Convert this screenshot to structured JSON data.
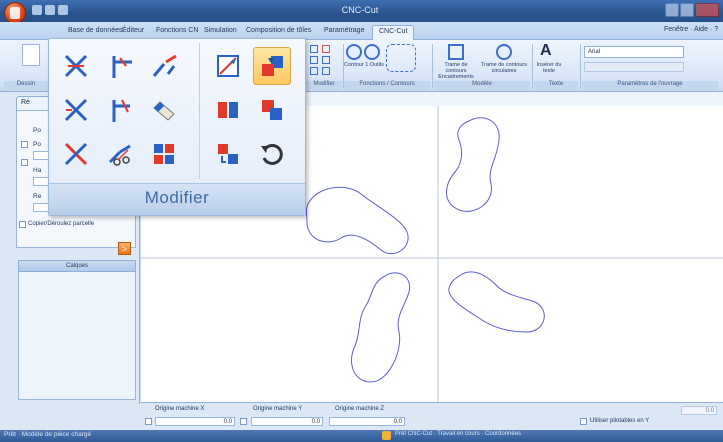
{
  "window": {
    "title": "CNC-Cut"
  },
  "tabs": [
    {
      "label": "Base de données"
    },
    {
      "label": "Éditeur"
    },
    {
      "label": "Fonctions CN"
    },
    {
      "label": "Simulation"
    },
    {
      "label": "Composition de tôles"
    },
    {
      "label": "Paramétrage"
    },
    {
      "label": "CNC-Cut"
    }
  ],
  "help_links": {
    "text": "Fenêtre · Aide · ?"
  },
  "ribbon": {
    "groups": [
      {
        "label": "Dessin"
      },
      {
        "label": "Modifier"
      },
      {
        "label": "Fonctions / Contours"
      },
      {
        "label": "Modèle"
      },
      {
        "label": "Texte"
      },
      {
        "label": "Paramètres de l'ouvrage"
      }
    ],
    "buttons": [
      {
        "label": "Contour 1 Outils"
      },
      {
        "label": "Contour 1 Outils"
      },
      {
        "label": "Trame de contours Encadrements"
      },
      {
        "label": "Trame de contours circulaires"
      },
      {
        "label": "Insérer du texte"
      }
    ],
    "font_name": "Arial",
    "text_icon": "A"
  },
  "left_panel": {
    "doc_tab": "Ré",
    "fields": [
      {
        "label": "Po"
      },
      {
        "label": "Po"
      },
      {
        "label": "Ha"
      },
      {
        "label": "Re"
      }
    ],
    "checkbox_label": "Copier/Déroulez parcelle",
    "list_header": "Calques",
    "orange_btn": ">"
  },
  "popup": {
    "title": "Modifier",
    "tools": [
      {
        "name": "trim-tool",
        "selected": false
      },
      {
        "name": "extend-tool",
        "selected": false
      },
      {
        "name": "break-tool",
        "selected": false
      },
      {
        "name": "stretch-tool",
        "selected": false
      },
      {
        "name": "properties-tool",
        "selected": true
      },
      {
        "name": "delete-tool",
        "selected": false
      },
      {
        "name": "corner-tool",
        "selected": false
      },
      {
        "name": "eraser-tool",
        "selected": false
      },
      {
        "name": "mirror-tool",
        "selected": false
      },
      {
        "name": "align-tool",
        "selected": false
      },
      {
        "name": "split-tool",
        "selected": false
      },
      {
        "name": "cut-tool",
        "selected": false
      },
      {
        "name": "array-tool",
        "selected": false
      },
      {
        "name": "move-tool",
        "selected": false
      },
      {
        "name": "undo-tool",
        "selected": false
      }
    ]
  },
  "coord_bar": {
    "labels": [
      "Origine machine X",
      "Origine machine Y",
      "Origine machine Z"
    ],
    "values": [
      "0.0",
      "0.0",
      "0.0",
      "0.0"
    ],
    "check_label": "Utiliser pilotables en Y"
  },
  "status": {
    "left": "Prêt · Modèle de pièce chargé",
    "right": "Prêt   CNC-Cut  ·  Travail en cours  ·  Coordonnées"
  },
  "colors": {
    "accent": "#3d6ca8",
    "shape_stroke": "#5a5fcf",
    "axis": "#b9c6d6",
    "selected": "#ffc861"
  }
}
